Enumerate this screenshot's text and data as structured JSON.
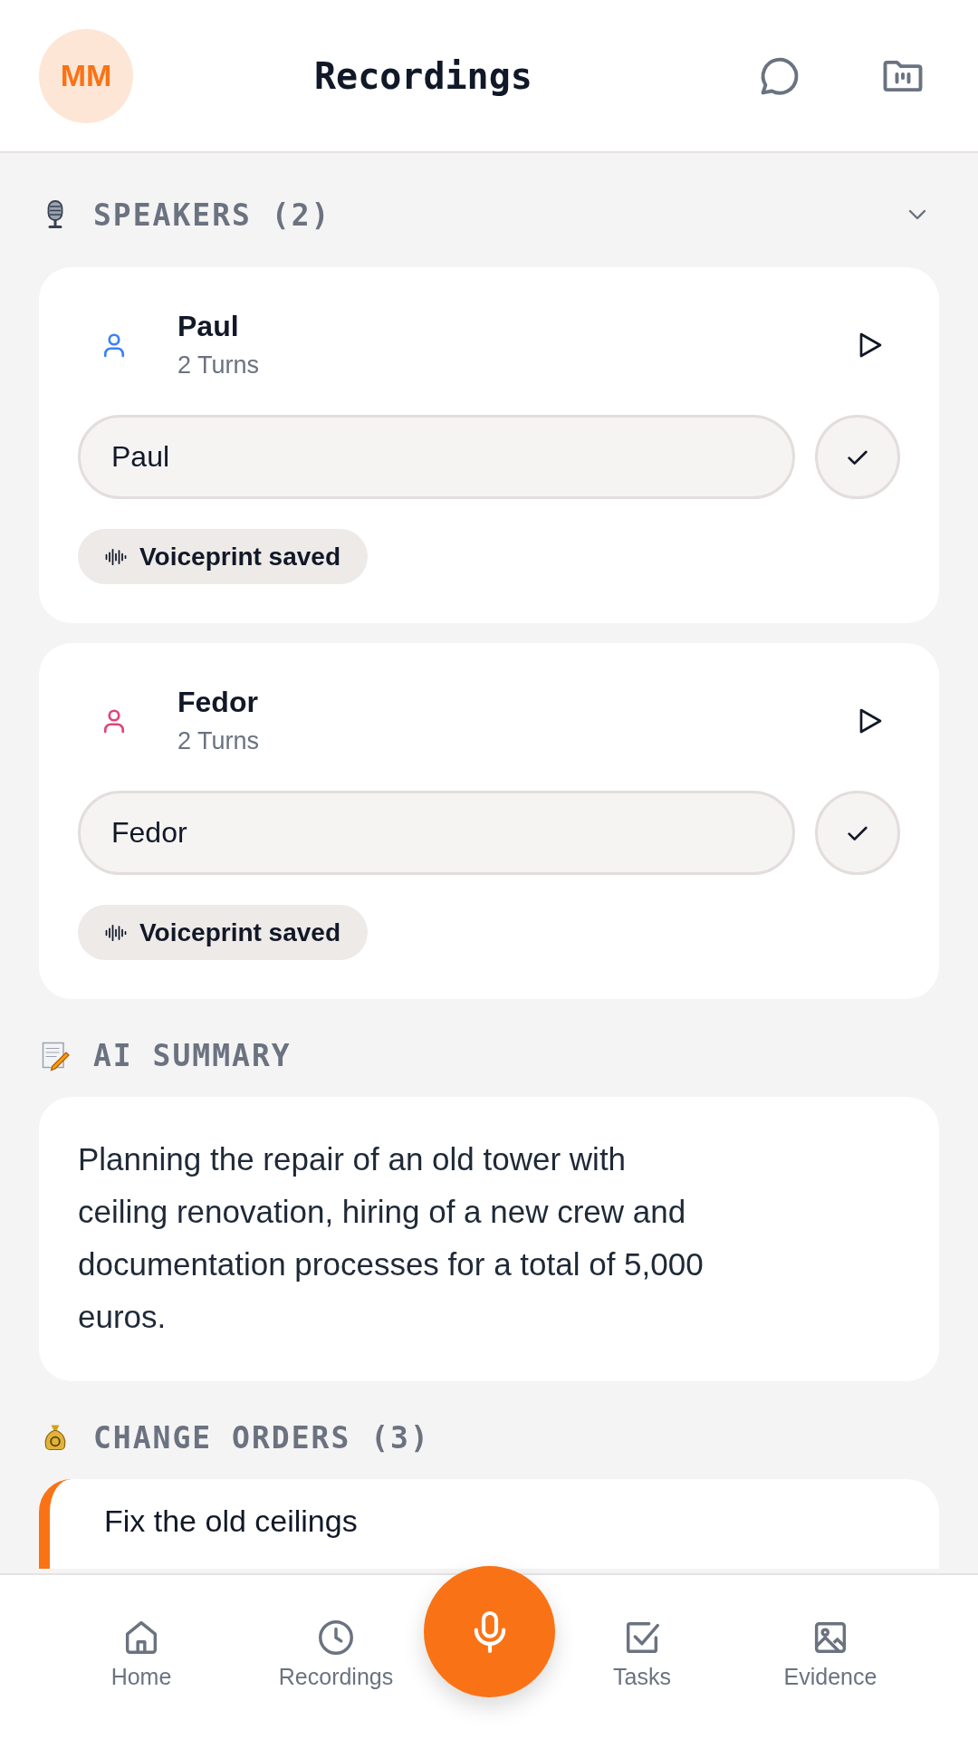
{
  "header": {
    "avatar": "MM",
    "title": "Recordings"
  },
  "speakers": {
    "heading": "SPEAKERS (2)",
    "expanded": true,
    "items": [
      {
        "name": "Paul",
        "turns": "2 Turns",
        "color": "#3b82f6",
        "value": "Paul",
        "voiceprint": "Voiceprint saved"
      },
      {
        "name": "Fedor",
        "turns": "2 Turns",
        "color": "#e0457b",
        "value": "Fedor",
        "voiceprint": "Voiceprint saved"
      }
    ]
  },
  "summary": {
    "heading": "AI SUMMARY",
    "text": "Planning the repair of an old tower with ceiling renovation, hiring of a new crew and documentation processes for a total of 5,000 euros."
  },
  "change_orders": {
    "heading": "CHANGE ORDERS (3)",
    "items": [
      {
        "title": "Fix the old ceilings"
      }
    ]
  },
  "nav": [
    {
      "label": "Home",
      "kind": "home",
      "selected": false
    },
    {
      "label": "Recordings",
      "kind": "clock",
      "selected": false
    },
    {
      "label": "Tasks",
      "kind": "check",
      "selected": false
    },
    {
      "label": "Evidence",
      "kind": "image",
      "selected": false
    }
  ]
}
